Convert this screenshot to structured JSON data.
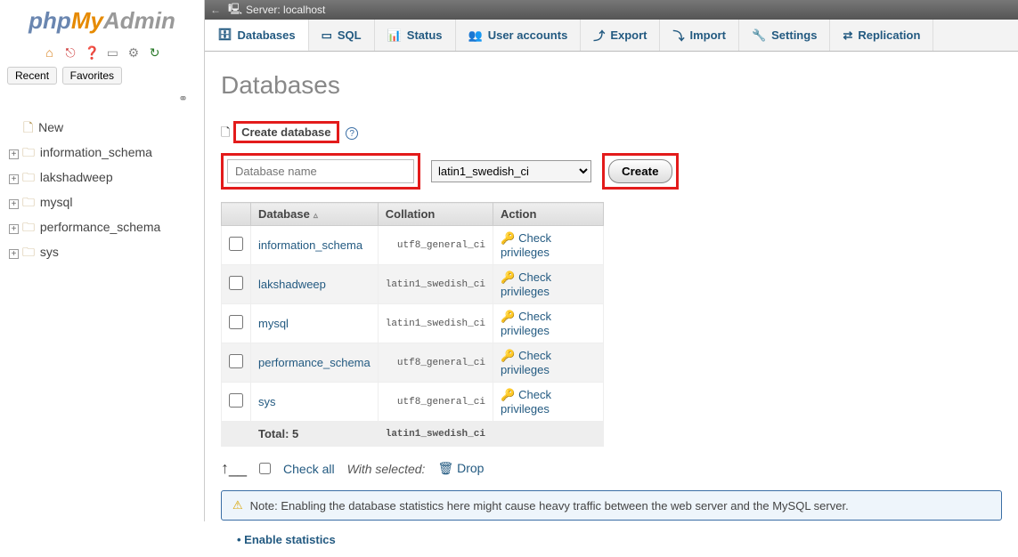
{
  "logo": {
    "p1": "php",
    "p2": "My",
    "p3": "Admin"
  },
  "sidebar_tabs": {
    "recent": "Recent",
    "favorites": "Favorites"
  },
  "tree": {
    "new": "New",
    "items": [
      "information_schema",
      "lakshadweep",
      "mysql",
      "performance_schema",
      "sys"
    ]
  },
  "server": {
    "label": "Server: localhost"
  },
  "tabs": [
    "Databases",
    "SQL",
    "Status",
    "User accounts",
    "Export",
    "Import",
    "Settings",
    "Replication"
  ],
  "page_title": "Databases",
  "create": {
    "label": "Create database",
    "placeholder": "Database name",
    "collation": "latin1_swedish_ci",
    "button": "Create"
  },
  "table": {
    "headers": {
      "db": "Database",
      "coll": "Collation",
      "act": "Action"
    },
    "rows": [
      {
        "name": "information_schema",
        "collation": "utf8_general_ci",
        "action": "Check privileges"
      },
      {
        "name": "lakshadweep",
        "collation": "latin1_swedish_ci",
        "action": "Check privileges"
      },
      {
        "name": "mysql",
        "collation": "latin1_swedish_ci",
        "action": "Check privileges"
      },
      {
        "name": "performance_schema",
        "utf8_general_ci": "utf8_general_ci",
        "collation": "utf8_general_ci",
        "action": "Check privileges"
      },
      {
        "name": "sys",
        "collation": "utf8_general_ci",
        "action": "Check privileges"
      }
    ],
    "footer": {
      "label": "Total: 5",
      "collation": "latin1_swedish_ci"
    }
  },
  "bulk": {
    "checkall": "Check all",
    "withsel": "With selected:",
    "drop": "Drop"
  },
  "notice": "Note: Enabling the database statistics here might cause heavy traffic between the web server and the MySQL server.",
  "enable": "Enable statistics"
}
